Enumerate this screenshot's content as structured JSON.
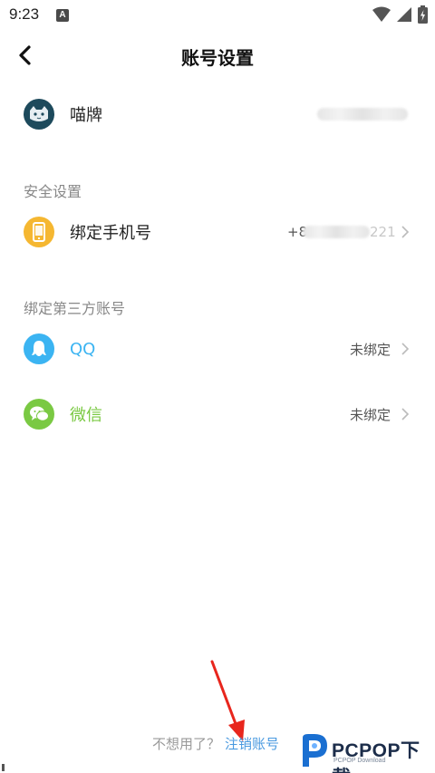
{
  "status_bar": {
    "time": "9:23",
    "notification_icon": "A"
  },
  "header": {
    "title": "账号设置"
  },
  "profile": {
    "name": "喵牌"
  },
  "security_section": {
    "title": "安全设置",
    "phone_label": "绑定手机号",
    "phone_prefix": "+8",
    "phone_suffix": "221"
  },
  "third_party_section": {
    "title": "绑定第三方账号",
    "items": [
      {
        "label": "QQ",
        "status": "未绑定",
        "color": "#3bb4f2"
      },
      {
        "label": "微信",
        "status": "未绑定",
        "color": "#7ac943"
      }
    ]
  },
  "footer": {
    "prompt": "不想用了？",
    "link": "注销账号"
  },
  "watermark": {
    "brand": "PCPOP下载",
    "sub": "PCPOP Download"
  },
  "colors": {
    "link": "#4a9ae0",
    "phone_icon_bg": "#f5b731",
    "arrow": "#e8261d"
  }
}
